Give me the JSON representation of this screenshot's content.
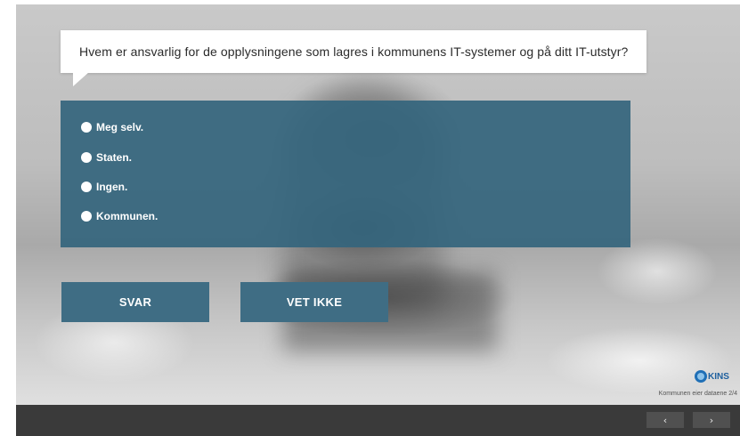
{
  "question": {
    "text": "Hvem er ansvarlig for de opplysningene som lagres i kommunens IT-systemer og på ditt IT-utstyr?"
  },
  "options": [
    {
      "label": "Meg selv.",
      "selected": false
    },
    {
      "label": "Staten.",
      "selected": false
    },
    {
      "label": "Ingen.",
      "selected": false
    },
    {
      "label": "Kommunen.",
      "selected": false
    }
  ],
  "buttons": {
    "submit_label": "SVAR",
    "dont_know_label": "VET IKKE"
  },
  "branding": {
    "logo_text": "KINS"
  },
  "footer": {
    "slide_caption": "Kommunen eier dataene 2/4",
    "prev_icon": "‹",
    "next_icon": "›"
  },
  "colors": {
    "panel": "#34657d",
    "button": "#3f6d84",
    "bottom_bar": "#3a3a3a"
  }
}
